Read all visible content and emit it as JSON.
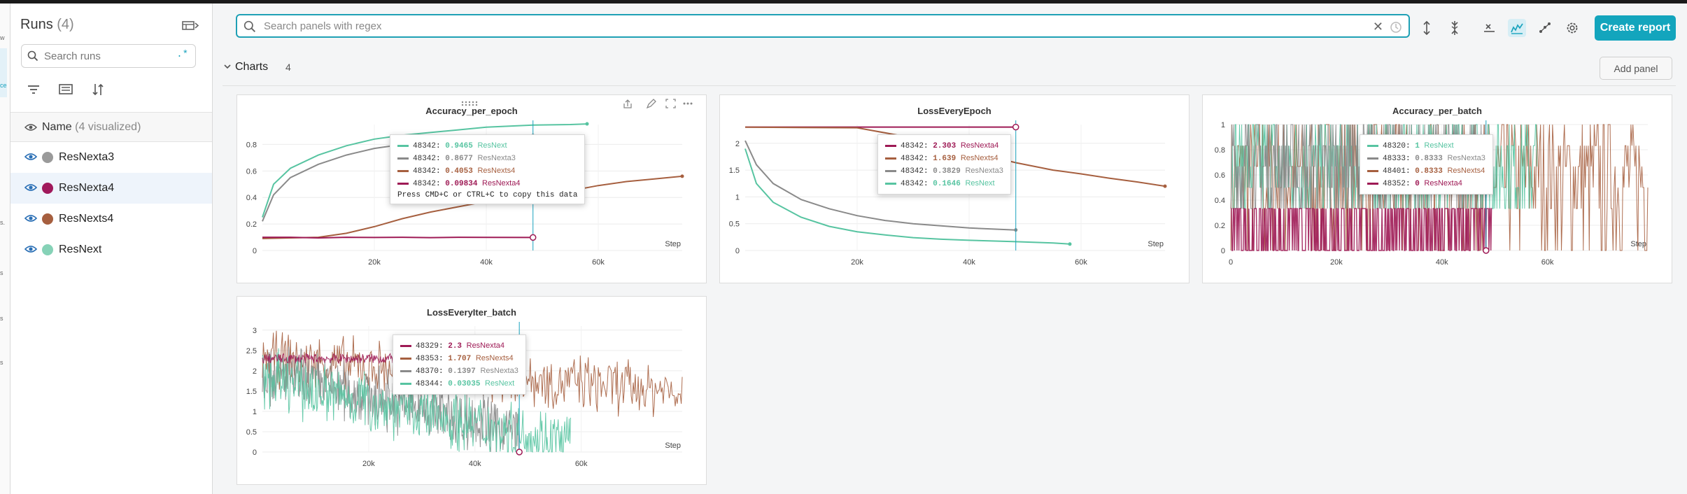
{
  "sidebar": {
    "title": "Runs",
    "count": "(4)",
    "search": {
      "placeholder": "Search runs",
      "regex": ".*"
    },
    "name_header": "Name",
    "visualized": "(4 visualized)",
    "runs": [
      {
        "name": "ResNexta3",
        "color": "#9a9a9a"
      },
      {
        "name": "ResNexta4",
        "color": "#a0195b"
      },
      {
        "name": "ResNexts4",
        "color": "#a65f3f"
      },
      {
        "name": "ResNext",
        "color": "#86d2b7"
      }
    ]
  },
  "leftstrip": {
    "hints": [
      "w",
      "ce",
      "s.",
      "s",
      "s",
      "s"
    ]
  },
  "toolbar": {
    "search_placeholder": "Search panels with regex",
    "clear": "✕",
    "create_report": "Create report",
    "add_panel": "Add panel"
  },
  "section": {
    "title": "Charts",
    "count": "4"
  },
  "colors": {
    "ResNext": "#57c4a1",
    "ResNexta3": "#8a8a8a",
    "ResNexts4": "#a65f3f",
    "ResNexta4": "#9e1a55",
    "accent": "#13a5bd"
  },
  "chart_data": [
    {
      "type": "line",
      "title": "Accuracy_per_epoch",
      "xlabel": "Step",
      "xlim": [
        0,
        75000
      ],
      "ylim": [
        0,
        0.95
      ],
      "xticks": [
        "20k",
        "40k",
        "60k"
      ],
      "xtick_values": [
        20000,
        40000,
        60000
      ],
      "yticks": [
        "0",
        "0.2",
        "0.4",
        "0.6",
        "0.8"
      ],
      "ytick_values": [
        0,
        0.2,
        0.4,
        0.6,
        0.8
      ],
      "hover_x": 48342,
      "series": [
        {
          "name": "ResNext",
          "color": "#57c4a1",
          "x": [
            0,
            2000,
            5000,
            10000,
            15000,
            20000,
            25000,
            30000,
            35000,
            40000,
            48342,
            55000,
            58000
          ],
          "y": [
            0.25,
            0.5,
            0.62,
            0.72,
            0.79,
            0.84,
            0.87,
            0.89,
            0.91,
            0.93,
            0.9465,
            0.95,
            0.955
          ]
        },
        {
          "name": "ResNexta3",
          "color": "#8a8a8a",
          "x": [
            0,
            2000,
            5000,
            10000,
            15000,
            20000,
            25000,
            30000,
            35000,
            40000,
            48342
          ],
          "y": [
            0.22,
            0.42,
            0.55,
            0.65,
            0.72,
            0.77,
            0.8,
            0.82,
            0.84,
            0.855,
            0.8677
          ]
        },
        {
          "name": "ResNexts4",
          "color": "#a65f3f",
          "x": [
            0,
            10000,
            15000,
            20000,
            25000,
            30000,
            35000,
            40000,
            48342,
            55000,
            60000,
            65000,
            70000,
            75000
          ],
          "y": [
            0.09,
            0.1,
            0.13,
            0.18,
            0.24,
            0.29,
            0.33,
            0.37,
            0.4053,
            0.45,
            0.49,
            0.52,
            0.54,
            0.56
          ]
        },
        {
          "name": "ResNexta4",
          "color": "#9e1a55",
          "x": [
            0,
            5000,
            10000,
            15000,
            20000,
            25000,
            30000,
            35000,
            40000,
            48342
          ],
          "y": [
            0.1,
            0.1,
            0.095,
            0.1,
            0.098,
            0.1,
            0.097,
            0.1,
            0.099,
            0.09834
          ]
        }
      ],
      "tooltip": [
        {
          "step": "48342",
          "value": "0.9465",
          "run": "ResNext",
          "color": "#57c4a1"
        },
        {
          "step": "48342",
          "value": "0.8677",
          "run": "ResNexta3",
          "color": "#8a8a8a"
        },
        {
          "step": "48342",
          "value": "0.4053",
          "run": "ResNexts4",
          "color": "#a65f3f"
        },
        {
          "step": "48342",
          "value": "0.09834",
          "run": "ResNexta4",
          "color": "#9e1a55"
        }
      ],
      "tooltip_note": "Press CMD+C or CTRL+C to copy this data"
    },
    {
      "type": "line",
      "title": "LossEveryEpoch",
      "xlabel": "Step",
      "xlim": [
        0,
        75000
      ],
      "ylim": [
        0,
        2.35
      ],
      "xticks": [
        "20k",
        "40k",
        "60k"
      ],
      "xtick_values": [
        20000,
        40000,
        60000
      ],
      "yticks": [
        "0",
        "0.5",
        "1",
        "1.5",
        "2"
      ],
      "ytick_values": [
        0,
        0.5,
        1,
        1.5,
        2
      ],
      "hover_x": 48342,
      "series": [
        {
          "name": "ResNexta4",
          "color": "#9e1a55",
          "x": [
            0,
            10000,
            20000,
            30000,
            40000,
            48342
          ],
          "y": [
            2.303,
            2.303,
            2.303,
            2.303,
            2.303,
            2.303
          ]
        },
        {
          "name": "ResNexts4",
          "color": "#a65f3f",
          "x": [
            0,
            20000,
            30000,
            40000,
            48342,
            55000,
            60000,
            65000,
            70000,
            75000
          ],
          "y": [
            2.3,
            2.29,
            2.1,
            1.85,
            1.639,
            1.5,
            1.43,
            1.35,
            1.28,
            1.2
          ]
        },
        {
          "name": "ResNexta3",
          "color": "#8a8a8a",
          "x": [
            0,
            2000,
            5000,
            10000,
            15000,
            20000,
            25000,
            30000,
            35000,
            40000,
            48342
          ],
          "y": [
            2.05,
            1.6,
            1.25,
            0.95,
            0.78,
            0.65,
            0.56,
            0.5,
            0.46,
            0.42,
            0.3829
          ]
        },
        {
          "name": "ResNext",
          "color": "#57c4a1",
          "x": [
            0,
            2000,
            5000,
            10000,
            15000,
            20000,
            25000,
            30000,
            35000,
            40000,
            48342,
            55000,
            58000
          ],
          "y": [
            1.9,
            1.25,
            0.9,
            0.62,
            0.45,
            0.35,
            0.29,
            0.24,
            0.21,
            0.19,
            0.1646,
            0.14,
            0.12
          ]
        }
      ],
      "tooltip": [
        {
          "step": "48342",
          "value": "2.303",
          "run": "ResNexta4",
          "color": "#9e1a55"
        },
        {
          "step": "48342",
          "value": "1.639",
          "run": "ResNexts4",
          "color": "#a65f3f"
        },
        {
          "step": "48342",
          "value": "0.3829",
          "run": "ResNexta3",
          "color": "#8a8a8a"
        },
        {
          "step": "48342",
          "value": "0.1646",
          "run": "ResNext",
          "color": "#57c4a1"
        }
      ]
    },
    {
      "type": "line",
      "title": "Accuracy_per_batch",
      "xlabel": "Step",
      "xlim": [
        0,
        79000
      ],
      "ylim": [
        0,
        1
      ],
      "xticks": [
        "0",
        "20k",
        "40k",
        "60k"
      ],
      "xtick_values": [
        0,
        20000,
        40000,
        60000
      ],
      "yticks": [
        "0",
        "0.2",
        "0.4",
        "0.6",
        "0.8",
        "1"
      ],
      "ytick_values": [
        0,
        0.2,
        0.4,
        0.6,
        0.8,
        1
      ],
      "hover_x": 48352,
      "series": [
        {
          "name": "ResNexts4",
          "color": "#a65f3f",
          "x_range": [
            0,
            79000
          ],
          "noise": {
            "kind": "dense",
            "levels": [
              0,
              0.333,
              0.5,
              0.667,
              0.833,
              1
            ]
          }
        },
        {
          "name": "ResNext",
          "color": "#57c4a1",
          "x_range": [
            0,
            58000
          ],
          "noise": {
            "kind": "dense",
            "levels": [
              0.333,
              0.5,
              0.667,
              0.833,
              1
            ]
          }
        },
        {
          "name": "ResNexta3",
          "color": "#8a8a8a",
          "x_range": [
            0,
            48333
          ],
          "noise": {
            "kind": "dense",
            "levels": [
              0.333,
              0.5,
              0.667,
              0.833,
              1
            ]
          }
        },
        {
          "name": "ResNexta4",
          "color": "#9e1a55",
          "x_range": [
            0,
            49500
          ],
          "noise": {
            "kind": "binary",
            "levels": [
              0,
              0.333
            ]
          }
        }
      ],
      "tooltip": [
        {
          "step": "48320",
          "value": "1",
          "run": "ResNext",
          "color": "#57c4a1"
        },
        {
          "step": "48333",
          "value": "0.8333",
          "run": "ResNexta3",
          "color": "#8a8a8a"
        },
        {
          "step": "48401",
          "value": "0.8333",
          "run": "ResNexts4",
          "color": "#a65f3f"
        },
        {
          "step": "48352",
          "value": "0",
          "run": "ResNexta4",
          "color": "#9e1a55"
        }
      ]
    },
    {
      "type": "line",
      "title": "LossEveryIter_batch",
      "xlabel": "Step",
      "xlim": [
        0,
        79000
      ],
      "ylim": [
        0,
        3.1
      ],
      "xticks": [
        "20k",
        "40k",
        "60k"
      ],
      "xtick_values": [
        20000,
        40000,
        60000
      ],
      "yticks": [
        "0",
        "0.5",
        "1",
        "1.5",
        "2",
        "2.5",
        "3"
      ],
      "ytick_values": [
        0,
        0.5,
        1,
        1.5,
        2,
        2.5,
        3
      ],
      "hover_x": 48344,
      "series": [
        {
          "name": "ResNexts4",
          "color": "#a65f3f",
          "x_range": [
            0,
            79000
          ],
          "noise": {
            "kind": "decay",
            "start": 2.3,
            "end": 1.5,
            "spread": 0.8
          }
        },
        {
          "name": "ResNexta3",
          "color": "#8a8a8a",
          "x_range": [
            0,
            48370
          ],
          "noise": {
            "kind": "decay",
            "start": 2.0,
            "end": 0.5,
            "spread": 0.9
          }
        },
        {
          "name": "ResNext",
          "color": "#57c4a1",
          "x_range": [
            0,
            58000
          ],
          "noise": {
            "kind": "decay",
            "start": 1.8,
            "end": 0.2,
            "spread": 0.9
          }
        },
        {
          "name": "ResNexta4",
          "color": "#9e1a55",
          "x_range": [
            0,
            48329
          ],
          "noise": {
            "kind": "flat",
            "start": 2.3,
            "end": 2.3,
            "spread": 0.12
          }
        }
      ],
      "tooltip": [
        {
          "step": "48329",
          "value": "2.3",
          "run": "ResNexta4",
          "color": "#9e1a55"
        },
        {
          "step": "48353",
          "value": "1.707",
          "run": "ResNexts4",
          "color": "#a65f3f"
        },
        {
          "step": "48370",
          "value": "0.1397",
          "run": "ResNexta3",
          "color": "#8a8a8a"
        },
        {
          "step": "48344",
          "value": "0.03035",
          "run": "ResNext",
          "color": "#57c4a1"
        }
      ]
    }
  ]
}
